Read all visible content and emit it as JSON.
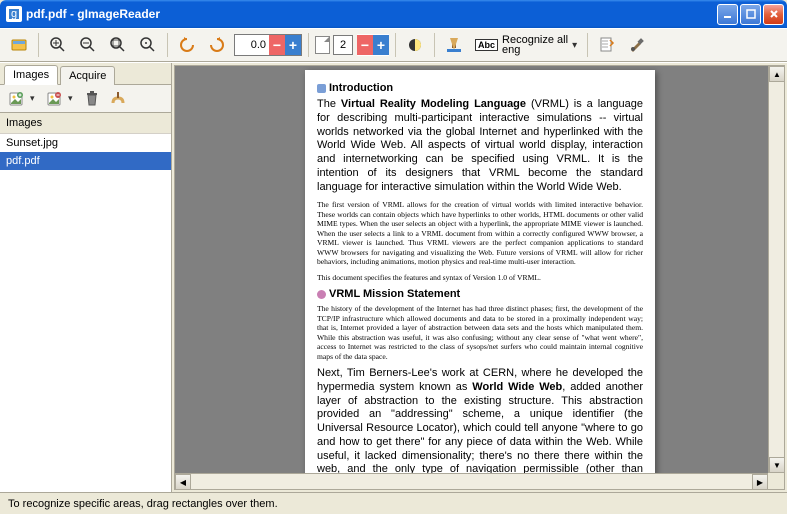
{
  "window": {
    "title": "pdf.pdf - gImageReader"
  },
  "toolbar": {
    "zoom_value": "0.0",
    "page_value": "2",
    "recognize_line1": "Recognize all",
    "recognize_line2": "eng"
  },
  "sidebar": {
    "tabs": {
      "images": "Images",
      "acquire": "Acquire"
    },
    "heading": "Images",
    "files": [
      "Sunset.jpg",
      "pdf.pdf"
    ],
    "selected_index": 1
  },
  "document": {
    "h1": "Introduction",
    "p1a": "The ",
    "p1b": "Virtual Reality Modeling Language",
    "p1c": " (VRML) is a language for describing multi-participant interactive simulations -- virtual worlds networked via the global Internet and hyperlinked with the World Wide Web. All aspects of virtual world display, interaction and internetworking can be specified using VRML. It is the intention of its designers that VRML become the standard language for interactive simulation within the World Wide Web.",
    "p2": "The first version of VRML allows for the creation of virtual worlds with limited interactive behavior. These worlds can contain objects which have hyperlinks to other worlds, HTML documents or other valid MIME types. When the user selects an object with a hyperlink, the appropriate MIME viewer is launched. When the user selects a link to a VRML document from within a correctly configured WWW browser, a VRML viewer is launched. Thus VRML viewers are the perfect companion applications to standard WWW browsers for navigating and visualizing the Web. Future versions of VRML will allow for richer behaviors, including animations, motion physics and real-time multi-user interaction.",
    "p3": "This document specifies the features and syntax of Version 1.0 of VRML.",
    "h2": "VRML Mission Statement",
    "p4": "The history of the development of the Internet has had three distinct phases; first, the development of the TCP/IP infrastructure which allowed documents and data to be stored in a proximally independent way; that is, Internet provided a layer of abstraction between data sets and the hosts which manipulated them. While this abstraction was useful, it was also confusing; without any clear sense of \"what went where\", access to Internet was restricted to the class of sysops/net surfers who could maintain internal cognitive maps of the data space.",
    "p5a": "Next, Tim Berners-Lee's work at CERN, where he developed the hypermedia system known as ",
    "p5b": "World Wide Web",
    "p5c": ", added another layer of abstraction to the existing structure. This abstraction provided an \"addressing\" scheme, a unique identifier (the Universal Resource Locator), which could tell anyone \"where to go and how to get there\" for any piece of data within the Web. While useful, it lacked dimensionality; there's no there there within the web, and the only type of navigation permissible (other than surfing) is by direct reference. In other words, I can only tell you how to get to the VRML Forum home page by saying, \"http://www.wired.com/\", which is not human-centered data. In"
  },
  "statusbar": {
    "text": "To recognize specific areas, drag rectangles over them."
  }
}
